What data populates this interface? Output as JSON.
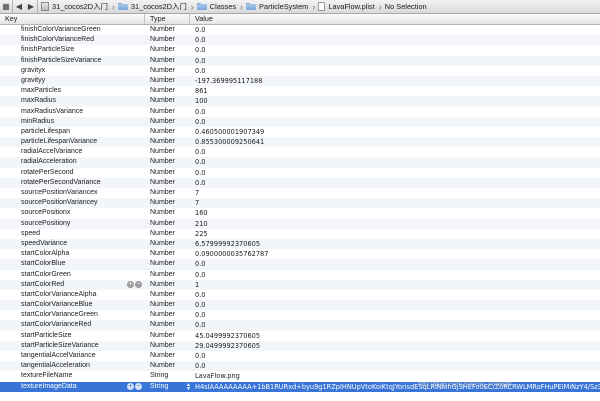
{
  "jumpbar": {
    "breadcrumbs": [
      {
        "label": "31_cocos2D入门",
        "icon": "project-icon"
      },
      {
        "label": "31_cocos2D入门",
        "icon": "folder-icon"
      },
      {
        "label": "Classes",
        "icon": "folder-icon"
      },
      {
        "label": "ParticleSystem",
        "icon": "folder-icon"
      },
      {
        "label": "LavaFlow.plist",
        "icon": "file-icon"
      },
      {
        "label": "No Selection",
        "icon": ""
      }
    ]
  },
  "table": {
    "headers": {
      "key": "Key",
      "type": "Type",
      "value": "Value"
    },
    "rows": [
      {
        "key": "finishColorVarianceGreen",
        "type": "Number",
        "value": "0.0"
      },
      {
        "key": "finishColorVarianceRed",
        "type": "Number",
        "value": "0.0"
      },
      {
        "key": "finishParticleSize",
        "type": "Number",
        "value": "0.0"
      },
      {
        "key": "finishParticleSizeVariance",
        "type": "Number",
        "value": "0.0"
      },
      {
        "key": "gravityx",
        "type": "Number",
        "value": "0.0"
      },
      {
        "key": "gravityy",
        "type": "Number",
        "value": "-197.369995117188"
      },
      {
        "key": "maxParticles",
        "type": "Number",
        "value": "861"
      },
      {
        "key": "maxRadius",
        "type": "Number",
        "value": "100"
      },
      {
        "key": "maxRadiusVariance",
        "type": "Number",
        "value": "0.0"
      },
      {
        "key": "minRadius",
        "type": "Number",
        "value": "0.0"
      },
      {
        "key": "particleLifespan",
        "type": "Number",
        "value": "0.460500001907349"
      },
      {
        "key": "particleLifespanVariance",
        "type": "Number",
        "value": "0.855300009250641"
      },
      {
        "key": "radialAccelVariance",
        "type": "Number",
        "value": "0.0"
      },
      {
        "key": "radialAcceleration",
        "type": "Number",
        "value": "0.0"
      },
      {
        "key": "rotatePerSecond",
        "type": "Number",
        "value": "0.0"
      },
      {
        "key": "rotatePerSecondVariance",
        "type": "Number",
        "value": "0.0"
      },
      {
        "key": "sourcePositionVariancex",
        "type": "Number",
        "value": "7"
      },
      {
        "key": "sourcePositionVariancey",
        "type": "Number",
        "value": "7"
      },
      {
        "key": "sourcePositionx",
        "type": "Number",
        "value": "160"
      },
      {
        "key": "sourcePositiony",
        "type": "Number",
        "value": "210"
      },
      {
        "key": "speed",
        "type": "Number",
        "value": "225"
      },
      {
        "key": "speedVariance",
        "type": "Number",
        "value": "6.57999992370605"
      },
      {
        "key": "startColorAlpha",
        "type": "Number",
        "value": "0.0900000035762787"
      },
      {
        "key": "startColorBlue",
        "type": "Number",
        "value": "0.0"
      },
      {
        "key": "startColorGreen",
        "type": "Number",
        "value": "0.0"
      },
      {
        "key": "startColorRed",
        "type": "Number",
        "value": "1",
        "controls": true
      },
      {
        "key": "startColorVarianceAlpha",
        "type": "Number",
        "value": "0.0"
      },
      {
        "key": "startColorVarianceBlue",
        "type": "Number",
        "value": "0.0"
      },
      {
        "key": "startColorVarianceGreen",
        "type": "Number",
        "value": "0.0"
      },
      {
        "key": "startColorVarianceRed",
        "type": "Number",
        "value": "0.0"
      },
      {
        "key": "startParticleSize",
        "type": "Number",
        "value": "45.0499992370605"
      },
      {
        "key": "startParticleSizeVariance",
        "type": "Number",
        "value": "29.0499992370605"
      },
      {
        "key": "tangentialAccelVariance",
        "type": "Number",
        "value": "0.0"
      },
      {
        "key": "tangentialAcceleration",
        "type": "Number",
        "value": "0.0"
      },
      {
        "key": "textureFileName",
        "type": "String",
        "value": "LavaFlow.png"
      },
      {
        "key": "textureImageData",
        "type": "String",
        "value": "H4sIAAAAAAAAA+1bB1RURxd+byu9g1RZpIHNUpVtoKoiKtqJYorisdESqLRINkihGjSHEFo0EC/ZoRCRWLMRoFHuPEIMiNzY4/Sz3fvic7Mrr",
        "controls": true,
        "selected": true
      }
    ]
  },
  "watermark": "http://blog.csdn.net/ccc_embedd"
}
